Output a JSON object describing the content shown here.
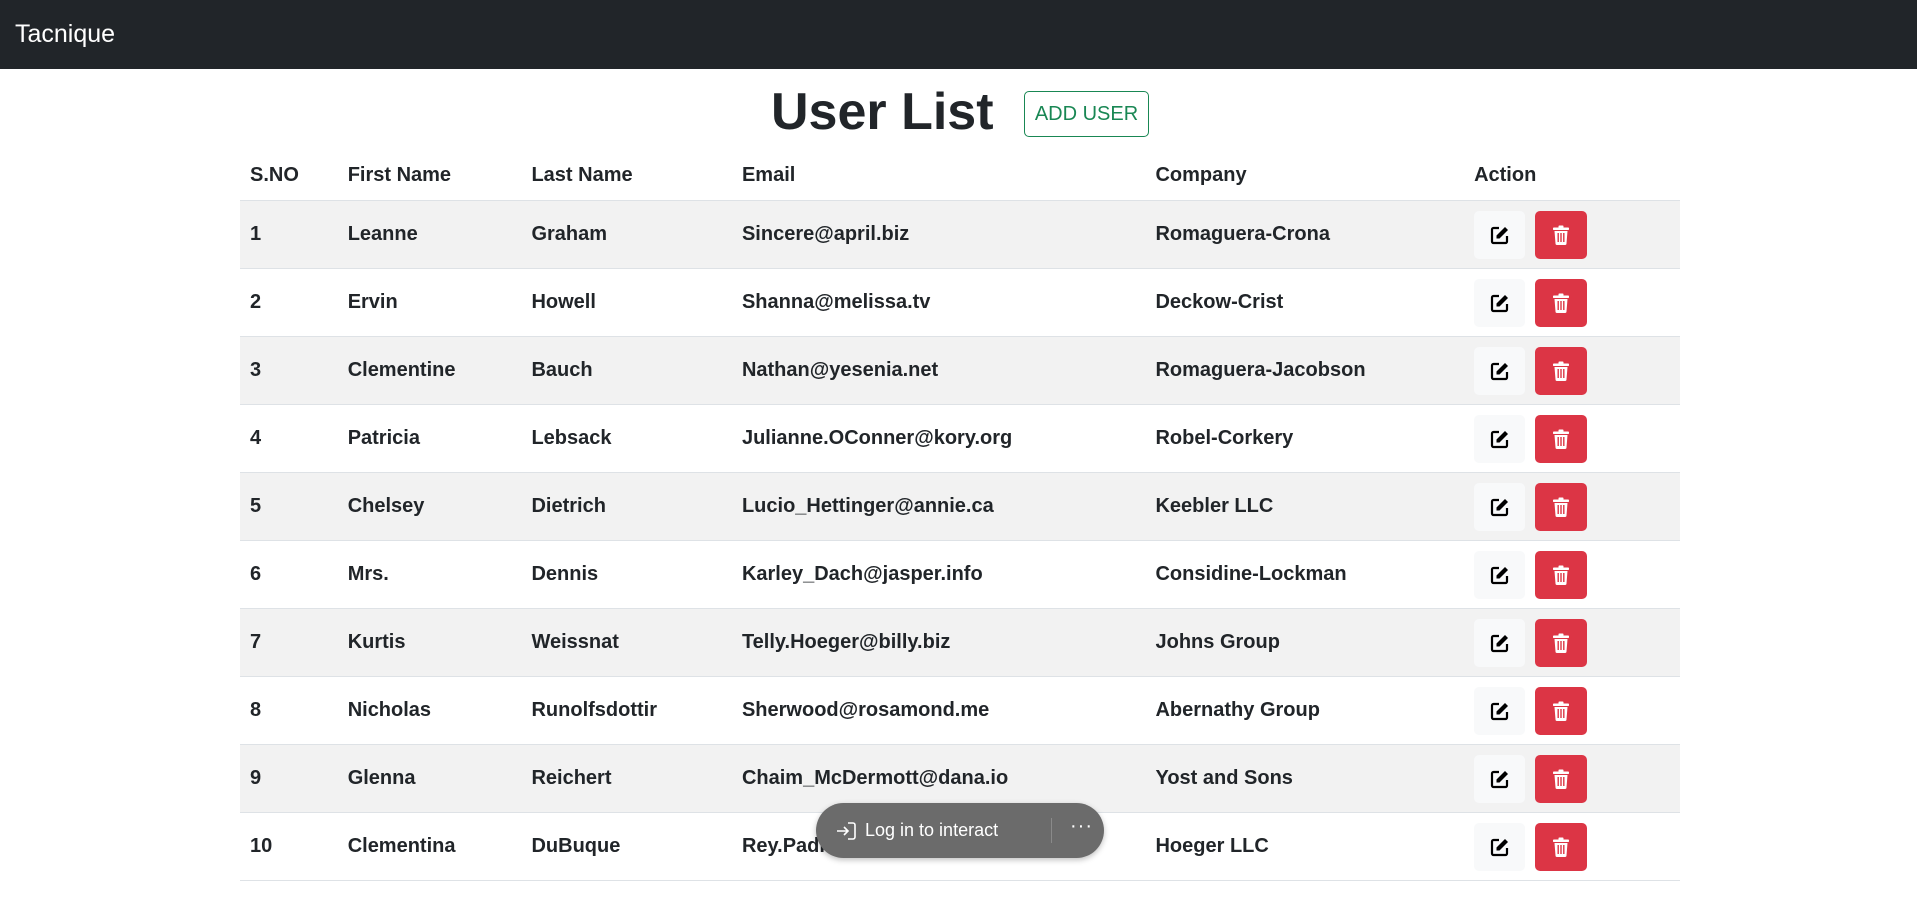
{
  "navbar": {
    "brand": "Tacnique"
  },
  "page": {
    "title": "User List",
    "add_button": "ADD USER"
  },
  "table": {
    "headers": {
      "sno": "S.NO",
      "first": "First Name",
      "last": "Last Name",
      "email": "Email",
      "company": "Company",
      "action": "Action"
    },
    "rows": [
      {
        "sno": "1",
        "first": "Leanne",
        "last": "Graham",
        "email": "Sincere@april.biz",
        "company": "Romaguera-Crona"
      },
      {
        "sno": "2",
        "first": "Ervin",
        "last": "Howell",
        "email": "Shanna@melissa.tv",
        "company": "Deckow-Crist"
      },
      {
        "sno": "3",
        "first": "Clementine",
        "last": "Bauch",
        "email": "Nathan@yesenia.net",
        "company": "Romaguera-Jacobson"
      },
      {
        "sno": "4",
        "first": "Patricia",
        "last": "Lebsack",
        "email": "Julianne.OConner@kory.org",
        "company": "Robel-Corkery"
      },
      {
        "sno": "5",
        "first": "Chelsey",
        "last": "Dietrich",
        "email": "Lucio_Hettinger@annie.ca",
        "company": "Keebler LLC"
      },
      {
        "sno": "6",
        "first": "Mrs.",
        "last": "Dennis",
        "email": "Karley_Dach@jasper.info",
        "company": "Considine-Lockman"
      },
      {
        "sno": "7",
        "first": "Kurtis",
        "last": "Weissnat",
        "email": "Telly.Hoeger@billy.biz",
        "company": "Johns Group"
      },
      {
        "sno": "8",
        "first": "Nicholas",
        "last": "Runolfsdottir",
        "email": "Sherwood@rosamond.me",
        "company": "Abernathy Group"
      },
      {
        "sno": "9",
        "first": "Glenna",
        "last": "Reichert",
        "email": "Chaim_McDermott@dana.io",
        "company": "Yost and Sons"
      },
      {
        "sno": "10",
        "first": "Clementina",
        "last": "DuBuque",
        "email": "Rey.Padi",
        "company": "Hoeger LLC"
      }
    ]
  },
  "toast": {
    "label": "Log in to interact",
    "more": "···"
  },
  "icons": {
    "edit": "edit-icon",
    "delete": "trash-icon",
    "login": "sign-in-icon"
  },
  "colors": {
    "navbar": "#212529",
    "add_button": "#198754",
    "delete_button": "#dc3545",
    "edit_button": "#f8f9fa",
    "stripe": "#f2f2f2",
    "toast": "#6b6b6b"
  }
}
